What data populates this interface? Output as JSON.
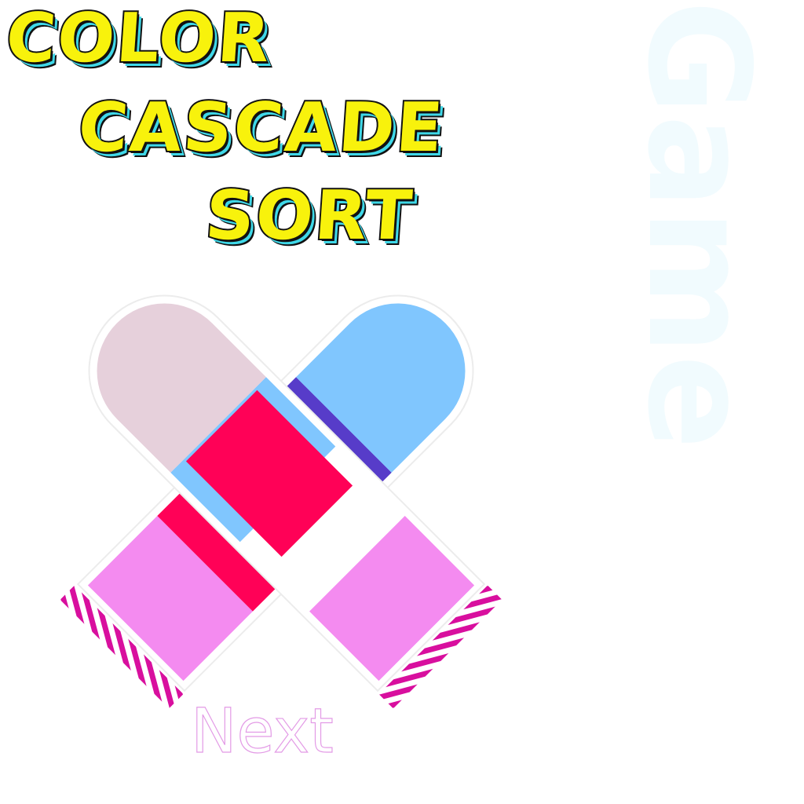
{
  "title": {
    "line1": "COLOR",
    "line2": "CASCADE",
    "line3": "SORT"
  },
  "watermark": "Game",
  "next_button": "Next",
  "colors": {
    "title_fill": "#f8f20c",
    "title_outline": "#111111",
    "title_shadow": "#3fd8e8",
    "tube_cap": "#d80f9e",
    "tube_outline": "#ffffff"
  },
  "tubes": [
    {
      "name": "tube-left",
      "cap_stripes": "magenta-white",
      "segments_top_to_bottom": [
        "#f48bf0",
        "#ff0157",
        "#573cc9",
        "#80c6fe"
      ]
    },
    {
      "name": "tube-right",
      "cap_stripes": "magenta-white",
      "segments_top_to_bottom": [
        "#f48bf0",
        "#ff0157",
        "#80c6fe",
        "#e6d0db"
      ]
    }
  ]
}
